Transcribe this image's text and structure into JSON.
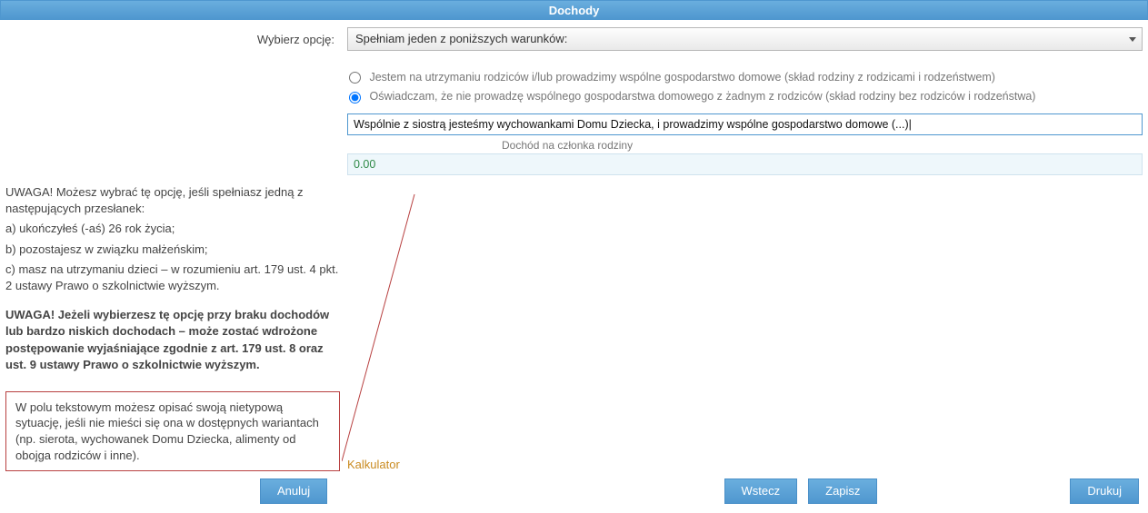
{
  "header": {
    "title": "Dochody"
  },
  "left": {
    "field_label": "Wybierz opcję:",
    "notes": {
      "intro": "UWAGA! Możesz wybrać tę opcję, jeśli spełniasz jedną z następujących przesłanek:",
      "a": "a) ukończyłeś (-aś) 26 rok życia;",
      "b": "b) pozostajesz w związku małżeńskim;",
      "c": "c) masz na utrzymaniu dzieci – w rozumieniu art. 179 ust. 4 pkt. 2 ustawy Prawo o szkolnictwie wyższym.",
      "warn": "UWAGA! Jeżeli wybierzesz tę opcję przy braku dochodów lub bardzo niskich dochodach – może zostać wdrożone postępowanie wyjaśniające zgodnie z art. 179 ust. 8 oraz ust. 9 ustawy Prawo o szkolnictwie wyższym."
    },
    "desc_box": "W polu tekstowym możesz opisać swoją nietypową sytuację, jeśli nie mieści się ona w dostępnych wariantach (np. sierota, wychowanek Domu Dziecka, alimenty od obojga rodziców i inne)."
  },
  "right": {
    "select_value": "Spełniam jeden z poniższych warunków:",
    "radio1": "Jestem na utrzymaniu rodziców i/lub prowadzimy wspólne gospodarstwo domowe (skład rodziny z rodzicami i rodzeństwem)",
    "radio2": "Oświadczam, że nie prowadzę wspólnego gospodarstwa domowego z żadnym z rodziców (skład rodziny bez rodziców i rodzeństwa)",
    "text_value": "Wspólnie z siostrą jesteśmy wychowankami Domu Dziecka, i prowadzimy wspólne gospodarstwo domowe (...)|",
    "income_label": "Dochód na członka rodziny",
    "income_value": "0.00",
    "kalkulator": "Kalkulator"
  },
  "buttons": {
    "anuluj": "Anuluj",
    "wstecz": "Wstecz",
    "zapisz": "Zapisz",
    "drukuj": "Drukuj"
  }
}
